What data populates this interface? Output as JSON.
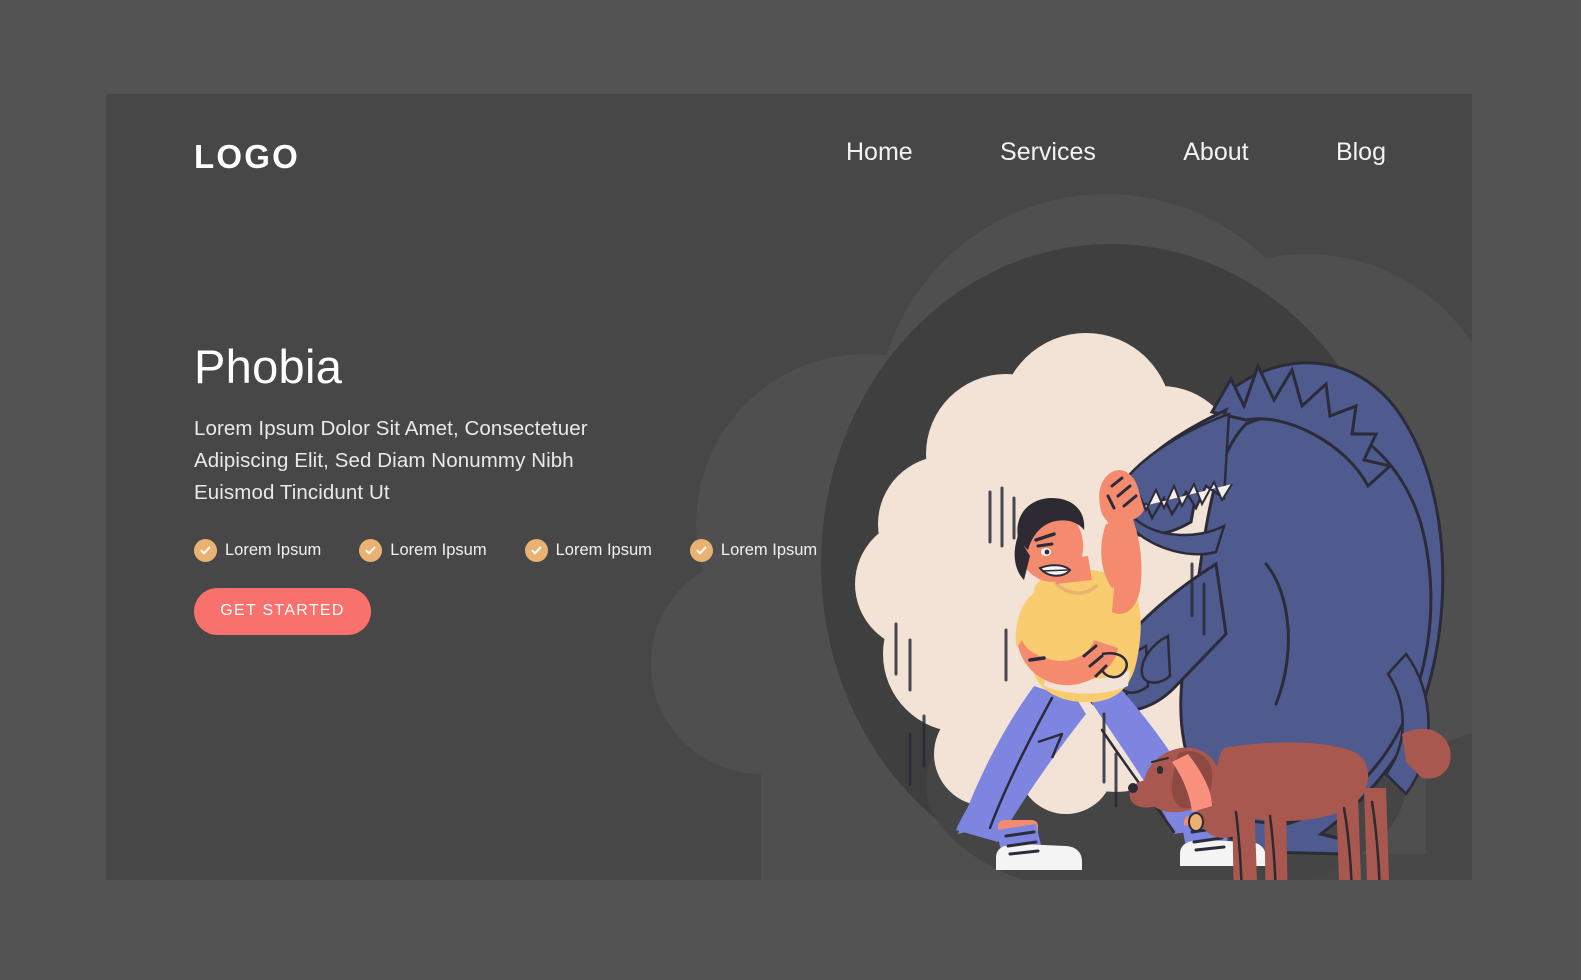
{
  "page": {
    "theme": "dark",
    "background_color": "#535353",
    "card_color": "#474747",
    "panel_color": "#3c3c3c"
  },
  "header": {
    "logo": "LOGO",
    "nav": [
      {
        "label": "Home",
        "name": "nav-home"
      },
      {
        "label": "Services",
        "name": "nav-services"
      },
      {
        "label": "About",
        "name": "nav-about"
      },
      {
        "label": "Blog",
        "name": "nav-blog"
      }
    ]
  },
  "hero": {
    "title": "Phobia",
    "subtitle": "Lorem Ipsum Dolor Sit Amet, Consectetuer Adipiscing Elit, Sed Diam Nonummy Nibh Euismod Tincidunt Ut",
    "features": [
      {
        "label": "Lorem Ipsum"
      },
      {
        "label": "Lorem Ipsum"
      },
      {
        "label": "Lorem Ipsum"
      },
      {
        "label": "Lorem Ipsum"
      }
    ],
    "cta_label": "GET STARTED",
    "cta_color": "#f9716c",
    "check_color": "#e9b273"
  },
  "illustration": {
    "name": "man-frightened-by-giant-wolf-shadow-and-dog",
    "colors": {
      "monster_blue": "#4f5a8f",
      "cloud_cream": "#f2e3d6",
      "shirt_yellow": "#f9cc70",
      "pants_blue": "#7d85e0",
      "skin": "#f58b6e",
      "hair_dark": "#2e2a33",
      "dog_brown": "#a8584f",
      "collar_pink": "#f9907e",
      "shoe_white": "#f4f4f4",
      "outline": "#2b2b3a",
      "backdrop_gray": "#4f4f4f",
      "spotlight_gray": "#3f3f3f"
    }
  }
}
